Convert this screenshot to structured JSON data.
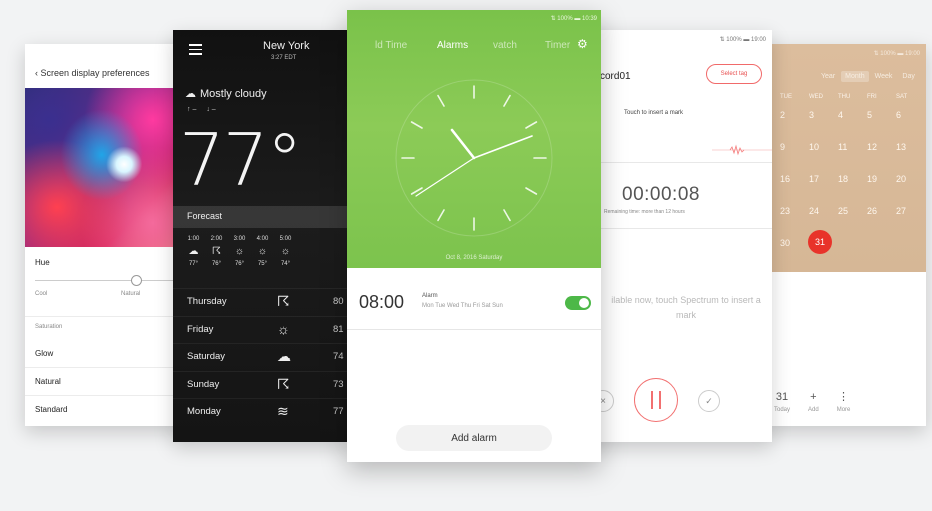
{
  "settings": {
    "header": "‹ Screen display preferences",
    "hue_label": "Hue",
    "slider_cool": "Cool",
    "slider_natural": "Natural",
    "saturation_label": "Saturation",
    "options": [
      "Glow",
      "Natural",
      "Standard"
    ]
  },
  "weather": {
    "city": "New York",
    "time": "3:27 EDT",
    "condition": "Mostly cloudy",
    "high": "↑ –",
    "low": "↓ –",
    "temperature": "77°",
    "forecast_label": "Forecast",
    "hourly": [
      {
        "time": "1:00",
        "icon": "partly-cloudy-icon",
        "temp": "77°"
      },
      {
        "time": "2:00",
        "icon": "thunder-icon",
        "temp": "76°"
      },
      {
        "time": "3:00",
        "icon": "sun-storm-icon",
        "temp": "76°"
      },
      {
        "time": "4:00",
        "icon": "sun-storm-icon",
        "temp": "75°"
      },
      {
        "time": "5:00",
        "icon": "sun-storm-icon",
        "temp": "74°"
      }
    ],
    "daily": [
      {
        "day": "Thursday",
        "icon": "thunder-icon",
        "temp": "80"
      },
      {
        "day": "Friday",
        "icon": "partly-sunny-icon",
        "temp": "81"
      },
      {
        "day": "Saturday",
        "icon": "cloud-icon",
        "temp": "74"
      },
      {
        "day": "Sunday",
        "icon": "thunder-icon",
        "temp": "73"
      },
      {
        "day": "Monday",
        "icon": "wind-icon",
        "temp": "77"
      }
    ]
  },
  "clock": {
    "status": "⇅ 100% ▬ 10:39",
    "tabs": {
      "world_time": "ld Time",
      "alarms": "Alarms",
      "stopwatch": "vatch",
      "timer": "Timer"
    },
    "date": "Oct 8, 2016  Saturday",
    "alarm": {
      "time": "08:00",
      "name": "Alarm",
      "days": "Mon Tue Wed Thu Fri Sat Sun",
      "enabled": true
    },
    "add_alarm": "Add alarm"
  },
  "recorder": {
    "status": "⇅ 100% ▬ 19:00",
    "title": "cord01",
    "select_tag": "Select tag",
    "hint": "Touch to insert a mark",
    "elapsed": "00:00:08",
    "remaining": "Remaining time: more than 12 hours",
    "empty_text": "ilable now, touch Spectrum to insert a mark",
    "controls": {
      "cancel": "×",
      "done": "✓"
    }
  },
  "calendar": {
    "status": "⇅ 100% ▬ 19:00",
    "views": [
      "Year",
      "Month",
      "Week",
      "Day"
    ],
    "selected_view": "Month",
    "weekdays": [
      "TUE",
      "WED",
      "THU",
      "FRI",
      "SAT"
    ],
    "dates": [
      "2",
      "3",
      "4",
      "5",
      "6",
      "9",
      "10",
      "11",
      "12",
      "13",
      "16",
      "17",
      "18",
      "19",
      "20",
      "23",
      "24",
      "25",
      "26",
      "27",
      "30"
    ],
    "today": "31",
    "bottom": [
      {
        "icon": "31",
        "label": "Today"
      },
      {
        "icon": "+",
        "label": "Add"
      },
      {
        "icon": "⋮",
        "label": "More"
      }
    ]
  }
}
